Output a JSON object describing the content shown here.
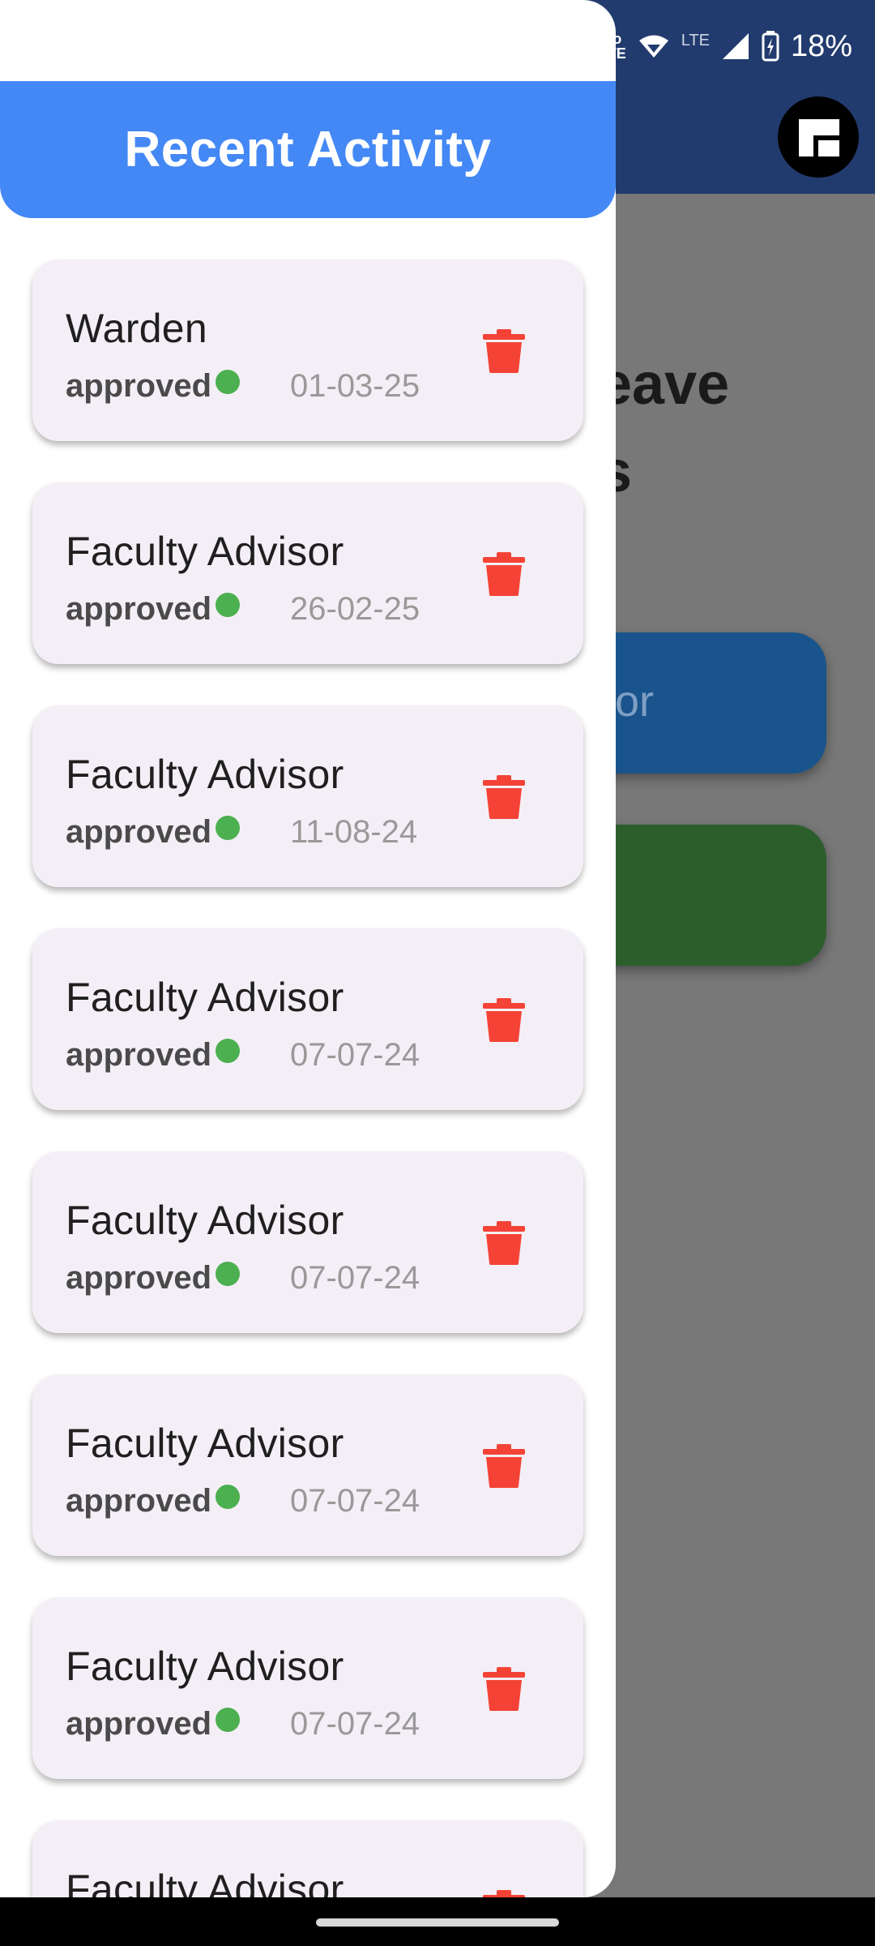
{
  "status_bar": {
    "volte_top": "Vo",
    "volte_bottom": "LTE",
    "lte": "LTE",
    "battery": "18%",
    "icons": [
      "volte-icon",
      "wifi-icon",
      "signal-icon",
      "battery-icon"
    ]
  },
  "background": {
    "title": "eave\ns",
    "button_label": "isor",
    "colors": {
      "appbar": "#223b6e",
      "button_blue": "#1a548c",
      "button_green": "#2c5e2c"
    }
  },
  "drawer": {
    "title": "Recent Activity",
    "header_color": "#4488f5",
    "items": [
      {
        "title": "Warden",
        "status": "approved",
        "date": "01-03-25"
      },
      {
        "title": "Faculty Advisor",
        "status": "approved",
        "date": "26-02-25"
      },
      {
        "title": "Faculty Advisor",
        "status": "approved",
        "date": "11-08-24"
      },
      {
        "title": "Faculty Advisor",
        "status": "approved",
        "date": "07-07-24"
      },
      {
        "title": "Faculty Advisor",
        "status": "approved",
        "date": "07-07-24"
      },
      {
        "title": "Faculty Advisor",
        "status": "approved",
        "date": "07-07-24"
      },
      {
        "title": "Faculty Advisor",
        "status": "approved",
        "date": "07-07-24"
      },
      {
        "title": "Faculty Advisor",
        "status": "",
        "date": ""
      }
    ],
    "status_color": "#4caf50",
    "delete_color": "#f44336"
  }
}
